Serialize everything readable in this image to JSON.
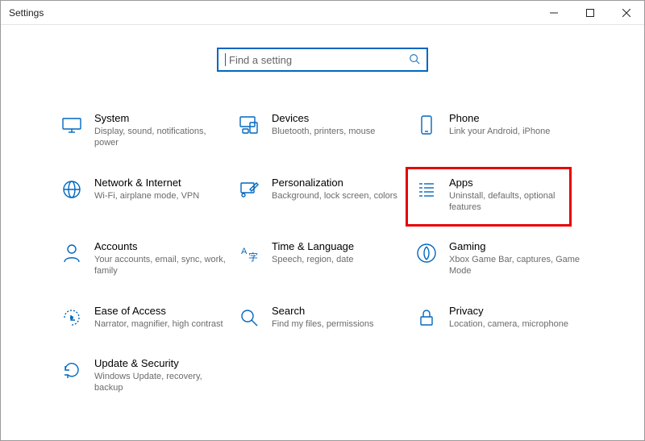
{
  "window": {
    "title": "Settings"
  },
  "search": {
    "placeholder": "Find a setting"
  },
  "tiles": {
    "system": {
      "title": "System",
      "desc": "Display, sound, notifications, power"
    },
    "devices": {
      "title": "Devices",
      "desc": "Bluetooth, printers, mouse"
    },
    "phone": {
      "title": "Phone",
      "desc": "Link your Android, iPhone"
    },
    "network": {
      "title": "Network & Internet",
      "desc": "Wi-Fi, airplane mode, VPN"
    },
    "personalization": {
      "title": "Personalization",
      "desc": "Background, lock screen, colors"
    },
    "apps": {
      "title": "Apps",
      "desc": "Uninstall, defaults, optional features"
    },
    "accounts": {
      "title": "Accounts",
      "desc": "Your accounts, email, sync, work, family"
    },
    "time": {
      "title": "Time & Language",
      "desc": "Speech, region, date"
    },
    "gaming": {
      "title": "Gaming",
      "desc": "Xbox Game Bar, captures, Game Mode"
    },
    "ease": {
      "title": "Ease of Access",
      "desc": "Narrator, magnifier, high contrast"
    },
    "search": {
      "title": "Search",
      "desc": "Find my files, permissions"
    },
    "privacy": {
      "title": "Privacy",
      "desc": "Location, camera, microphone"
    },
    "update": {
      "title": "Update & Security",
      "desc": "Windows Update, recovery, backup"
    }
  }
}
